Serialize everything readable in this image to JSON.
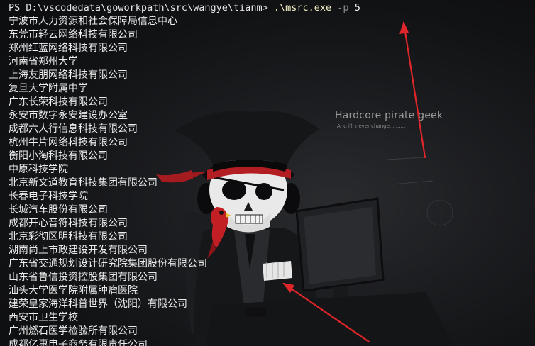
{
  "window": {
    "type": "terminal",
    "background_color": "#0e1013"
  },
  "prompt": {
    "text": "PS D:\\vscodedata\\goworkpath\\src\\wangye\\tianm> ",
    "command_exe": ".\\msrc.exe",
    "command_flag": "-p",
    "command_arg": "5"
  },
  "output_lines": [
    "宁波市人力资源和社会保障局信息中心",
    "东莞市轻云网络科技有限公司",
    "郑州红蓝网络科技有限公司",
    "河南省郑州大学",
    "上海友朋网络科技有限公司",
    "复旦大学附属中学",
    "广东长荣科技有限公司",
    "永安市数字永安建设办公室",
    "成都六人行信息科技有限公司",
    "杭州牛片网络科技有限公司",
    "衡阳小淘科技有限公司",
    "中原科技学院",
    "北京新文道教育科技集团有限公司",
    "长春电子科技学院",
    "长城汽车股份有限公司",
    "成都开心音符科技有限公司",
    "北京彩彻区明科技有限公司",
    "湖南尚上市政建设开发有限公司",
    "广东省交通规划设计研究院集团股份有限公司",
    "山东省鲁信投资控股集团有限公司",
    "汕头大学医学院附属肿瘤医院",
    "建荣皇家海洋科普世界（沈阳）有限公司",
    "西安市卫生学校",
    "广州燃石医学检验所有限公司",
    "成都亿惠电子商务有限责任公司"
  ],
  "wallpaper": {
    "tagline": "Hardcore pirate geek",
    "subline": "And i'll never change..........",
    "icon": "pirate-skull-icon"
  },
  "annotations": {
    "arrow_color": "#e0262a",
    "icon": "red-arrow-icon"
  }
}
